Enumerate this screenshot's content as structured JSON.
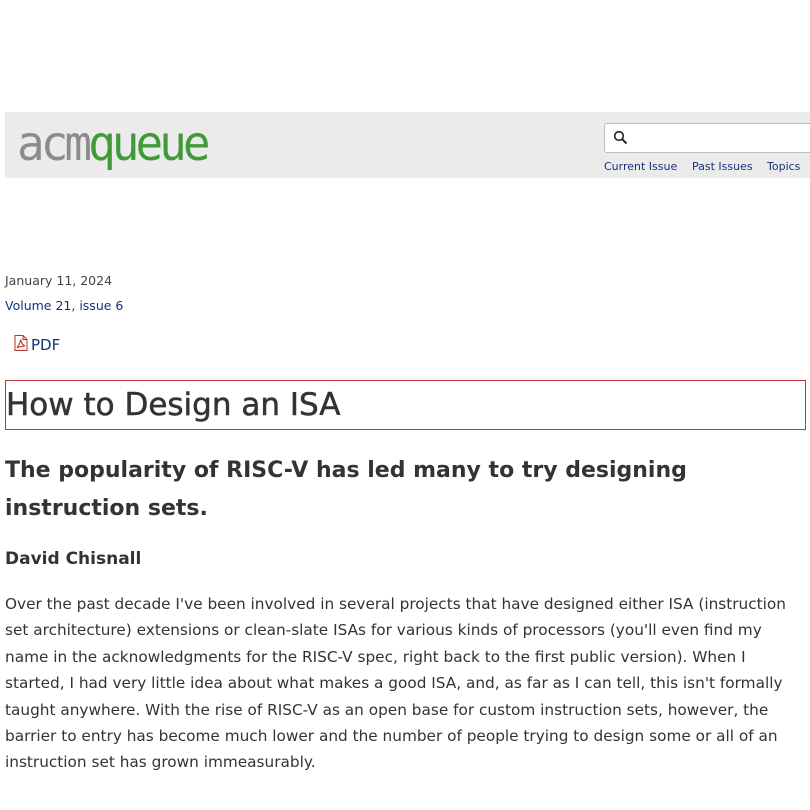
{
  "header": {
    "logo": {
      "acm": "acm",
      "queue": "queue"
    },
    "search": {
      "placeholder": "",
      "value": ""
    },
    "nav": [
      "Current Issue",
      "Past Issues",
      "Topics"
    ]
  },
  "article": {
    "date": "January 11, 2024",
    "volume": "Volume 21, issue 6",
    "pdf_label": "PDF",
    "title": "How to Design an ISA",
    "subtitle": "The popularity of RISC-V has led many to try designing instruction sets.",
    "author": "David Chisnall",
    "body": "Over the past decade I've been involved in several projects that have designed either ISA (instruction set architecture) extensions or clean-slate ISAs for various kinds of processors (you'll even find my name in the acknowledgments for the RISC-V spec, right back to the first public version). When I started, I had very little idea about what makes a good ISA, and, as far as I can tell, this isn't formally taught anywhere. With the rise of RISC-V as an open base for custom instruction sets, however, the barrier to entry has become much lower and the number of people trying to design some or all of an instruction set has grown immeasurably."
  },
  "colors": {
    "link": "#17307a",
    "logo_gray": "#8c8c8c",
    "logo_green": "#3f9a37",
    "title_border": "#c0353b"
  }
}
